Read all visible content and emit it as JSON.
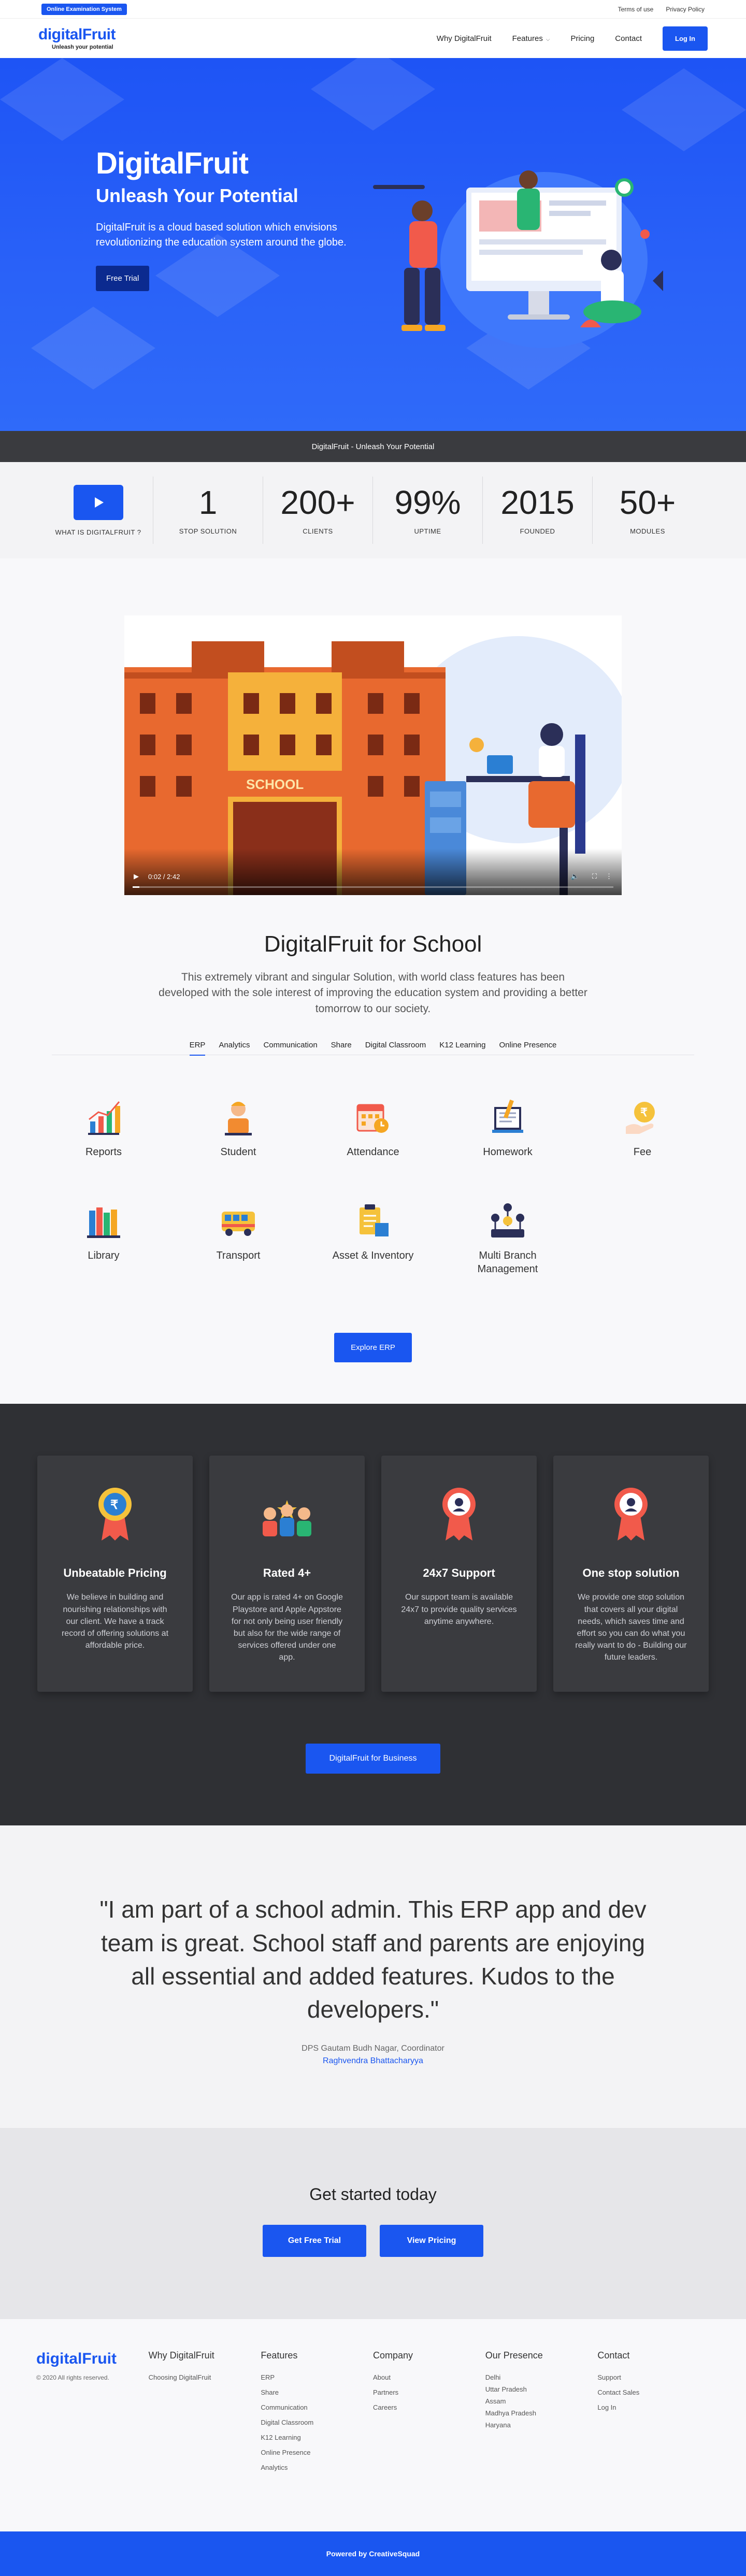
{
  "topbar": {
    "badge": "Online Examination System",
    "terms": "Terms of use",
    "privacy": "Privacy Policy"
  },
  "nav": {
    "logo": "digitalFruit",
    "tagline": "Unleash your potential",
    "items": [
      "Why DigitalFruit",
      "Features",
      "Pricing",
      "Contact"
    ],
    "login": "Log In"
  },
  "hero": {
    "title": "DigitalFruit",
    "subtitle": "Unleash Your Potential",
    "text": "DigitalFruit is a cloud based solution which envisions revolutionizing the education system around the globe.",
    "cta": "Free Trial"
  },
  "banner": "DigitalFruit - Unleash Your Potential",
  "stats": {
    "video_label": "WHAT IS DIGITALFRUIT ?",
    "items": [
      {
        "num": "1",
        "label": "STOP SOLUTION"
      },
      {
        "num": "200+",
        "label": "CLIENTS"
      },
      {
        "num": "99%",
        "label": "UPTIME"
      },
      {
        "num": "2015",
        "label": "FOUNDED"
      },
      {
        "num": "50+",
        "label": "MODULES"
      }
    ]
  },
  "video": {
    "time": "0:02 / 2:42",
    "school_sign": "SCHOOL",
    "progress": 0.014
  },
  "school": {
    "title": "DigitalFruit for School",
    "desc": "This extremely vibrant and singular Solution, with world class features has been developed with the sole interest of improving the education system and providing a better tomorrow to our society.",
    "tabs": [
      "ERP",
      "Analytics",
      "Communication",
      "Share",
      "Digital Classroom",
      "K12 Learning",
      "Online Presence"
    ],
    "features": [
      "Reports",
      "Student",
      "Attendance",
      "Homework",
      "Fee",
      "Library",
      "Transport",
      "Asset & Inventory",
      "Multi Branch Management"
    ],
    "cta": "Explore ERP"
  },
  "cards": [
    {
      "title": "Unbeatable Pricing",
      "text": "We believe in building and nourishing relationships with our client. We have a track record of offering solutions at affordable price."
    },
    {
      "title": "Rated 4+",
      "text": "Our app is rated 4+ on Google Playstore and Apple Appstore for not only being user friendly but also for the wide range of services offered under one app."
    },
    {
      "title": "24x7 Support",
      "text": "Our support team is available 24x7 to provide quality services anytime anywhere."
    },
    {
      "title": "One stop solution",
      "text": "We provide one stop solution that covers all your digital needs, which saves time and effort so you can do what you really want to do - Building our future leaders."
    }
  ],
  "business_cta": "DigitalFruit for Business",
  "testimonial": {
    "quote": "\"I am part of a school admin. This ERP app and dev team is great. School staff and parents are enjoying all essential and added features. Kudos to the developers.\"",
    "who": "DPS Gautam Budh Nagar, Coordinator",
    "name": "Raghvendra Bhattacharyya"
  },
  "cta": {
    "title": "Get started today",
    "trial": "Get Free Trial",
    "pricing": "View Pricing"
  },
  "footer": {
    "logo": "digitalFruit",
    "copy": "© 2020 All rights reserved.",
    "cols": [
      {
        "title": "Why DigitalFruit",
        "items": [
          "Choosing DigitalFruit"
        ]
      },
      {
        "title": "Features",
        "items": [
          "ERP",
          "Share",
          "Communication",
          "Digital Classroom",
          "K12 Learning",
          "Online Presence",
          "Analytics"
        ]
      },
      {
        "title": "Company",
        "items": [
          "About",
          "Partners",
          "Careers"
        ]
      },
      {
        "title": "Our Presence",
        "items": [
          "Delhi",
          "Uttar Pradesh",
          "Assam",
          "Madhya Pradesh",
          "Haryana"
        ]
      },
      {
        "title": "Contact",
        "items": [
          "Support",
          "Contact Sales",
          "Log In"
        ]
      }
    ],
    "powered": "Powered by CreativeSquad"
  },
  "colors": {
    "brand": "#1a56f0",
    "dark": "#2f3034",
    "banner": "#3a3b3f"
  }
}
